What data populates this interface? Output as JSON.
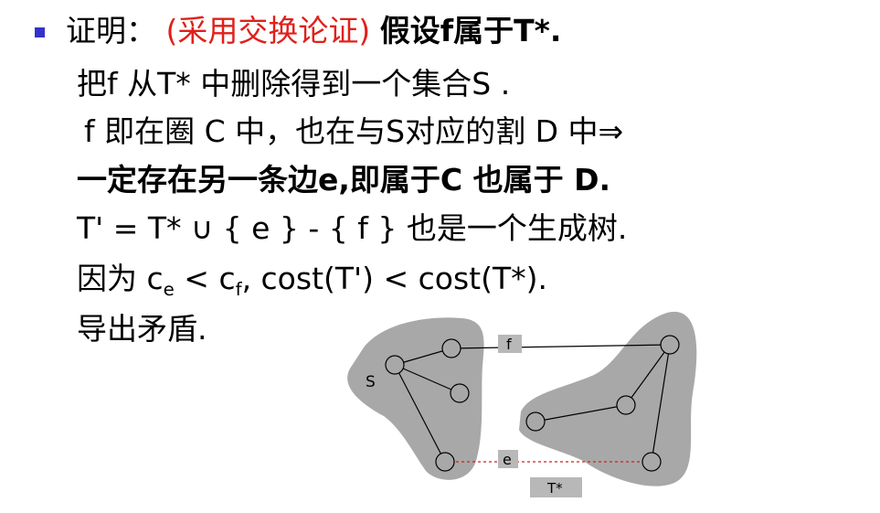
{
  "slide": {
    "line1": {
      "prefix": "证明：",
      "red": "(采用交换论证)",
      "bold": "假设f属于T*."
    },
    "line2": "把f 从T* 中删除得到一个集合S .",
    "line3": "f 即在圈 C 中，也在与S对应的割 D 中⇒",
    "line4": "一定存在另一条边e,即属于C 也属于 D.",
    "line5": "T' = T* ∪ { e } - { f } 也是一个生成树.",
    "line6": {
      "a": "因为 c",
      "sub_e": "e",
      "b": " < c",
      "sub_f": "f",
      "c": ", cost(T') < cost(T*)."
    },
    "line7": "导出矛盾."
  },
  "figure": {
    "label_s": "S",
    "label_f": "f",
    "label_e": "e",
    "label_tstar": "T*",
    "colors": {
      "blob": "#a8a8a8",
      "label_box": "#b8b8b8",
      "e_edge": "#cc2222"
    }
  }
}
